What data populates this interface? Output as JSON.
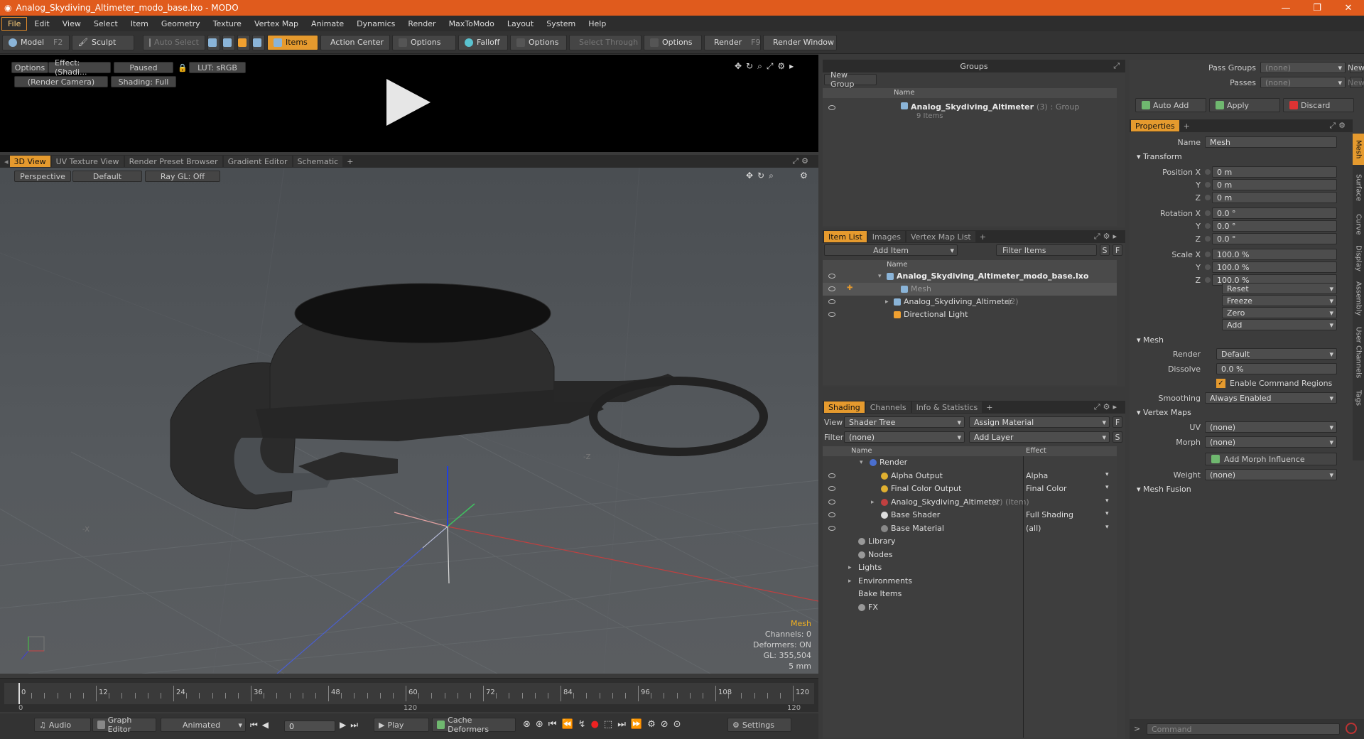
{
  "window": {
    "title": "Analog_Skydiving_Altimeter_modo_base.lxo - MODO"
  },
  "menu": [
    "File",
    "Edit",
    "View",
    "Select",
    "Item",
    "Geometry",
    "Texture",
    "Vertex Map",
    "Animate",
    "Dynamics",
    "Render",
    "MaxToModo",
    "Layout",
    "System",
    "Help"
  ],
  "toolbar": {
    "model": "Model",
    "model_key": "F2",
    "sculpt": "Sculpt",
    "auto_select": "Auto Select",
    "items": "Items",
    "action_center": "Action Center",
    "options1": "Options",
    "falloff": "Falloff",
    "options2": "Options",
    "select_through": "Select Through",
    "options3": "Options",
    "render": "Render",
    "render_key": "F9",
    "render_window": "Render Window"
  },
  "preview": {
    "options": "Options",
    "effect": "Effect: (Shadi...",
    "paused": "Paused",
    "lut": "LUT: sRGB",
    "camera": "(Render Camera)",
    "shading": "Shading: Full"
  },
  "viewport": {
    "tabs": [
      "3D View",
      "UV Texture View",
      "Render Preset Browser",
      "Gradient Editor",
      "Schematic"
    ],
    "add_tab": "+",
    "perspective": "Perspective",
    "default": "Default",
    "raygl": "Ray GL: Off",
    "axis_z": "-Z",
    "axis_x": "-X",
    "info": {
      "mesh": "Mesh",
      "channels": "Channels: 0",
      "deformers": "Deformers: ON",
      "gl": "GL: 355,504",
      "scale": "5 mm"
    }
  },
  "timeline": {
    "ticks": [
      "0",
      "12",
      "24",
      "36",
      "48",
      "60",
      "72",
      "84",
      "96",
      "108",
      "120"
    ],
    "sub_left": "0",
    "sub_mid": "120",
    "sub_right": "120"
  },
  "bottombar": {
    "audio": "Audio",
    "graph_editor": "Graph Editor",
    "animated": "Animated",
    "frame": "0",
    "play": "Play",
    "cache_deformers": "Cache Deformers",
    "settings": "Settings"
  },
  "groups": {
    "title": "Groups",
    "new_group": "New Group",
    "col_name": "Name",
    "item_name": "Analog_Skydiving_Altimeter",
    "item_count": "(3)",
    "item_type": ": Group",
    "item_sub": "9 Items"
  },
  "itemlist": {
    "tabs": [
      "Item List",
      "Images",
      "Vertex Map List"
    ],
    "add_tab": "+",
    "add_item": "Add Item",
    "filter_items": "Filter Items",
    "s": "S",
    "f": "F",
    "col_name": "Name",
    "rows": [
      {
        "name": "Analog_Skydiving_Altimeter_modo_base.lxo",
        "extra": ""
      },
      {
        "name": "Mesh",
        "extra": ""
      },
      {
        "name": "Analog_Skydiving_Altimeter",
        "extra": "(2)"
      },
      {
        "name": "Directional Light",
        "extra": ""
      }
    ]
  },
  "shading": {
    "tabs": [
      "Shading",
      "Channels",
      "Info & Statistics"
    ],
    "add_tab": "+",
    "view_label": "View",
    "view_value": "Shader Tree",
    "assign_material": "Assign Material",
    "f": "F",
    "filter_label": "Filter",
    "filter_value": "(none)",
    "add_layer": "Add Layer",
    "s": "S",
    "col_name": "Name",
    "col_effect": "Effect",
    "rows": [
      {
        "name": "Render",
        "extra": "",
        "effect": ""
      },
      {
        "name": "Alpha Output",
        "extra": "",
        "effect": "Alpha"
      },
      {
        "name": "Final Color Output",
        "extra": "",
        "effect": "Final Color"
      },
      {
        "name": "Analog_Skydiving_Altimeter",
        "extra": "(2) (Item)",
        "effect": ""
      },
      {
        "name": "Base Shader",
        "extra": "",
        "effect": "Full Shading"
      },
      {
        "name": "Base Material",
        "extra": "",
        "effect": "(all)"
      },
      {
        "name": "Library",
        "extra": "",
        "effect": ""
      },
      {
        "name": "Nodes",
        "extra": "",
        "effect": ""
      },
      {
        "name": "Lights",
        "extra": "",
        "effect": ""
      },
      {
        "name": "Environments",
        "extra": "",
        "effect": ""
      },
      {
        "name": "Bake Items",
        "extra": "",
        "effect": ""
      },
      {
        "name": "FX",
        "extra": "",
        "effect": ""
      }
    ]
  },
  "props": {
    "pass_groups": "Pass Groups",
    "pass_groups_val": "(none)",
    "new": "New",
    "passes": "Passes",
    "passes_val": "(none)",
    "new2": "New",
    "auto_add": "Auto Add",
    "apply": "Apply",
    "discard": "Discard",
    "tab": "Properties",
    "add_tab": "+",
    "name_label": "Name",
    "name_value": "Mesh",
    "transform": "Transform",
    "position_x": "Position X",
    "y": "Y",
    "z": "Z",
    "pos": [
      "0 m",
      "0 m",
      "0 m"
    ],
    "rotation_x": "Rotation X",
    "rot": [
      "0.0 °",
      "0.0 °",
      "0.0 °"
    ],
    "scale_x": "Scale X",
    "scl": [
      "100.0 %",
      "100.0 %",
      "100.0 %"
    ],
    "reset": "Reset",
    "freeze": "Freeze",
    "zero": "Zero",
    "add": "Add",
    "mesh": "Mesh",
    "render_label": "Render",
    "render_val": "Default",
    "dissolve_label": "Dissolve",
    "dissolve_val": "0.0 %",
    "enable_cmd": "Enable Command Regions",
    "smoothing_label": "Smoothing",
    "smoothing_val": "Always Enabled",
    "vertex_maps": "Vertex Maps",
    "uv_label": "UV",
    "uv_val": "(none)",
    "morph_label": "Morph",
    "morph_val": "(none)",
    "add_morph": "Add Morph Influence",
    "weight_label": "Weight",
    "weight_val": "(none)",
    "mesh_fusion": "Mesh Fusion",
    "command": "Command",
    "side_tabs": [
      "Mesh",
      "Surface",
      "Curve",
      "Display",
      "Assembly",
      "User Channels",
      "Tags"
    ]
  }
}
